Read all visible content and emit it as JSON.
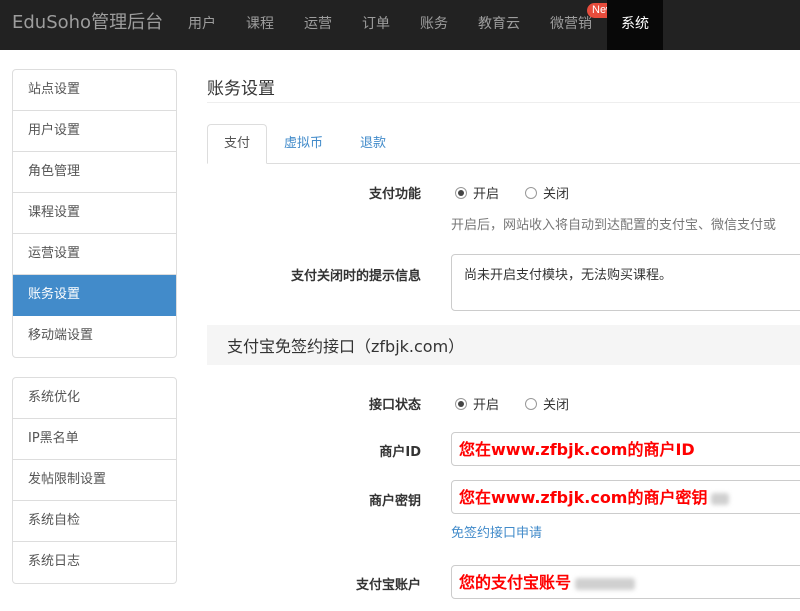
{
  "navbar": {
    "brand": "EduSoho管理后台",
    "items": [
      "用户",
      "课程",
      "运营",
      "订单",
      "账务",
      "教育云",
      "微营销",
      "系统"
    ],
    "new_badge": "New",
    "active_item": "系统"
  },
  "sidebar": {
    "group1": [
      "站点设置",
      "用户设置",
      "角色管理",
      "课程设置",
      "运营设置",
      "账务设置",
      "移动端设置"
    ],
    "group2": [
      "系统优化",
      "IP黑名单",
      "发帖限制设置",
      "系统自检",
      "系统日志"
    ],
    "active_item": "账务设置"
  },
  "main": {
    "title": "账务设置",
    "tabs": [
      "支付",
      "虚拟币",
      "退款"
    ],
    "active_tab": "支付",
    "payment": {
      "label": "支付功能",
      "on": "开启",
      "off": "关闭",
      "selected": "开启",
      "help": "开启后，网站收入将自动到达配置的支付宝、微信支付或"
    },
    "closed_message": {
      "label": "支付关闭时的提示信息",
      "value": "尚未开启支付模块，无法购买课程。"
    },
    "alipay_section": {
      "title": "支付宝免签约接口（zfbjk.com）",
      "status_label": "接口状态",
      "on": "开启",
      "off": "关闭",
      "selected": "开启",
      "merchant_id_label": "商户ID",
      "merchant_id_value": "您在www.zfbjk.com的商户ID",
      "merchant_key_label": "商户密钥",
      "merchant_key_value": "您在www.zfbjk.com的商户密钥",
      "apply_link": "免签约接口申请",
      "account_label": "支付宝账户",
      "account_value": "您的支付宝账号"
    }
  },
  "colors": {
    "navbar_bg": "#222222",
    "active_blue": "#428bca",
    "badge_red": "#e74c3c",
    "input_text_red": "#ff0000"
  }
}
